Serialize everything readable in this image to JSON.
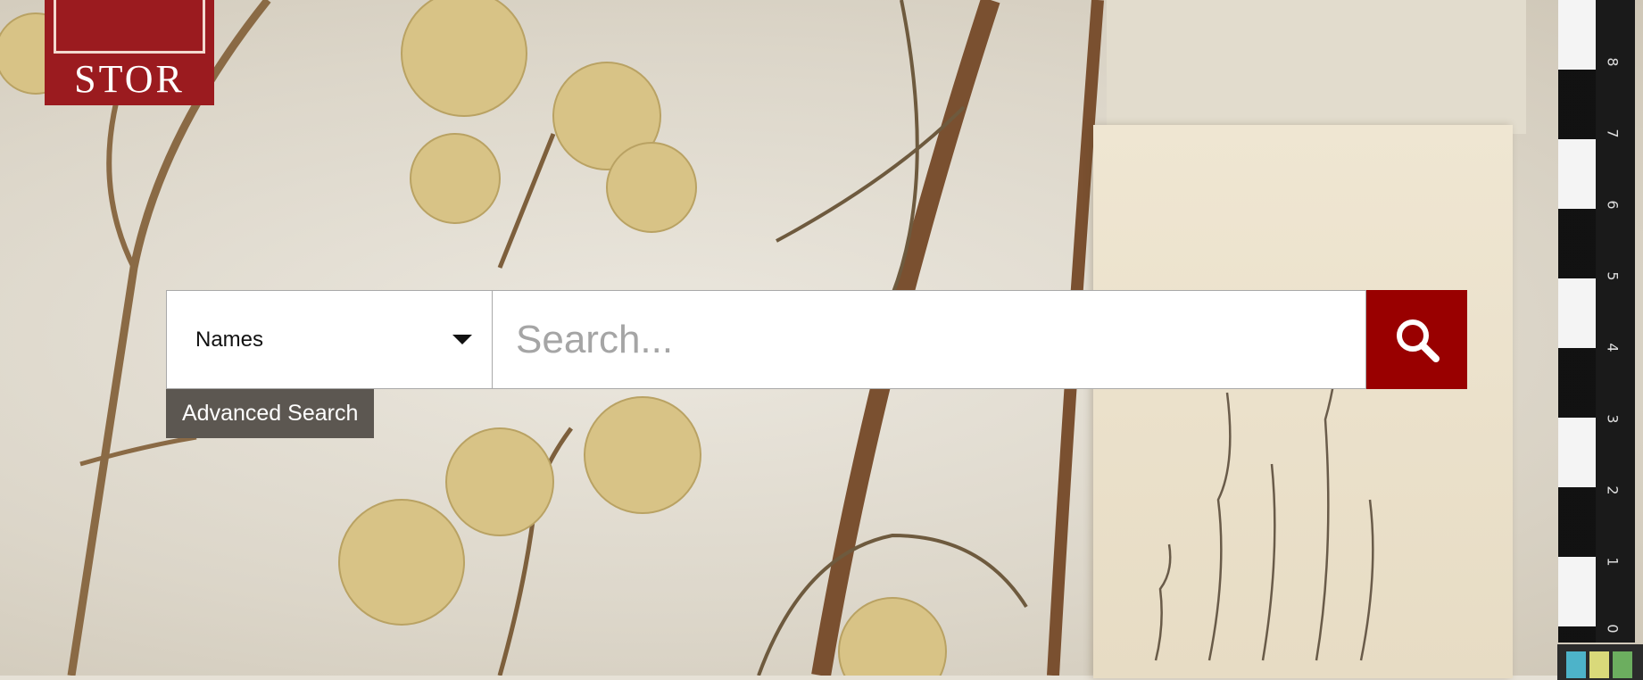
{
  "logo": {
    "text": "STOR"
  },
  "search": {
    "type_selected": "Names",
    "placeholder": "Search...",
    "value": "",
    "button_icon": "search-icon"
  },
  "advanced_search": {
    "label": "Advanced Search"
  },
  "ruler": {
    "numbers": [
      "8",
      "7",
      "6",
      "5",
      "4",
      "3",
      "2",
      "1",
      "0"
    ]
  },
  "colors": {
    "brand_red": "#990000",
    "adv_search_bg": "#5c5751"
  }
}
